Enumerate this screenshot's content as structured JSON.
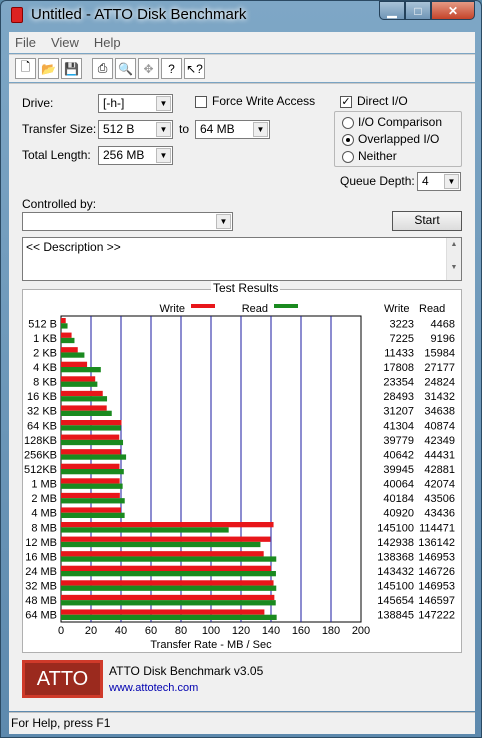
{
  "window": {
    "title": "Untitled - ATTO Disk Benchmark"
  },
  "menu": {
    "file": "File",
    "view": "View",
    "help": "Help"
  },
  "form": {
    "drive_label": "Drive:",
    "drive_value": "[-h-]",
    "force_write_label": "Force Write Access",
    "force_write_checked": false,
    "direct_io_label": "Direct I/O",
    "direct_io_checked": true,
    "transfer_size_label": "Transfer Size:",
    "transfer_from": "512 B",
    "to_label": "to",
    "transfer_to": "64 MB",
    "total_length_label": "Total Length:",
    "total_length": "256 MB",
    "io_comparison_label": "I/O Comparison",
    "overlapped_io_label": "Overlapped I/O",
    "neither_label": "Neither",
    "io_mode_selected": "Overlapped I/O",
    "queue_depth_label": "Queue Depth:",
    "queue_depth": "4",
    "controlled_by_label": "Controlled by:",
    "controlled_by_value": "",
    "start_label": "Start",
    "description": "<< Description >>"
  },
  "results": {
    "title": "Test Results",
    "write_legend": "Write",
    "read_legend": "Read",
    "write_col": "Write",
    "read_col": "Read"
  },
  "colors": {
    "write": "#e8161a",
    "read": "#1a8a1f",
    "grid": "#1a1aa0"
  },
  "chart_data": {
    "type": "bar",
    "orientation": "horizontal",
    "categories": [
      "512 B",
      "1 KB",
      "2 KB",
      "4 KB",
      "8 KB",
      "16 KB",
      "32 KB",
      "64 KB",
      "128KB",
      "256KB",
      "512KB",
      "1 MB",
      "2 MB",
      "4 MB",
      "8 MB",
      "12 MB",
      "16 MB",
      "24 MB",
      "32 MB",
      "48 MB",
      "64 MB"
    ],
    "series": [
      {
        "name": "Write",
        "values": [
          3223,
          7225,
          11433,
          17808,
          23354,
          28493,
          31207,
          41304,
          39779,
          40642,
          39945,
          40064,
          40184,
          40920,
          145100,
          142938,
          138368,
          143432,
          145100,
          145654,
          138845
        ]
      },
      {
        "name": "Read",
        "values": [
          4468,
          9196,
          15984,
          27177,
          24824,
          31432,
          34638,
          40874,
          42349,
          44431,
          42881,
          42074,
          43506,
          43436,
          114471,
          136142,
          146953,
          146726,
          146953,
          146597,
          147222
        ]
      }
    ],
    "xlabel": "Transfer Rate - MB / Sec",
    "xlim": [
      0,
      200
    ],
    "xticks": [
      "0",
      "20",
      "40",
      "60",
      "80",
      "100",
      "120",
      "140",
      "160",
      "180",
      "200"
    ],
    "grid": true,
    "legend": "top-center"
  },
  "footer": {
    "version": "ATTO Disk Benchmark v3.05",
    "url": "www.attotech.com",
    "logo": "ATTO"
  },
  "status": {
    "text": "For Help, press F1"
  }
}
